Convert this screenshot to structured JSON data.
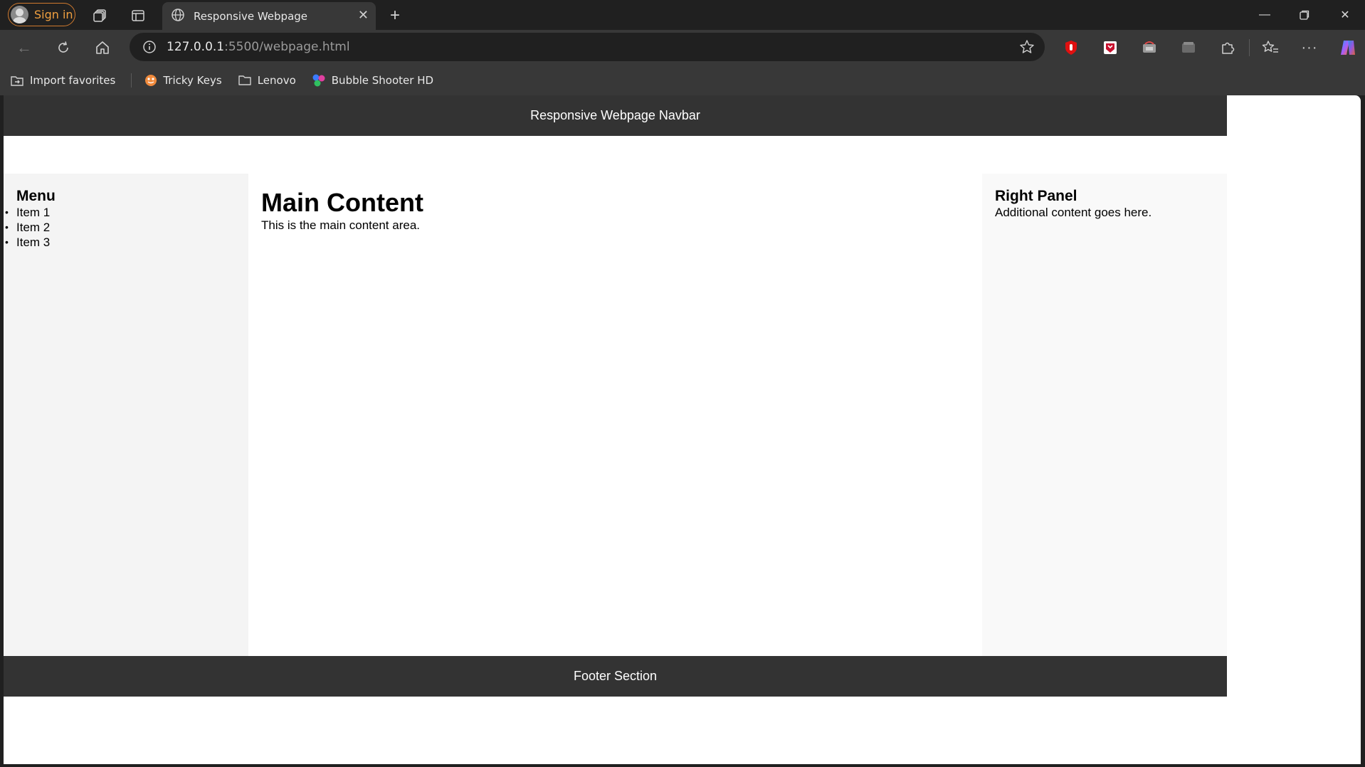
{
  "browser": {
    "signin_label": "Sign in",
    "tab_title": "Responsive Webpage",
    "url_host": "127.0.0.1",
    "url_path": ":5500/webpage.html",
    "bookmarks": [
      {
        "label": "Import favorites",
        "icon": "import-icon"
      },
      {
        "label": "Tricky Keys",
        "icon": "game-icon"
      },
      {
        "label": "Lenovo",
        "icon": "folder-icon"
      },
      {
        "label": "Bubble Shooter HD",
        "icon": "bubble-icon"
      }
    ],
    "accent_color": "#d07a2e"
  },
  "page": {
    "navbar_title": "Responsive Webpage Navbar",
    "menu": {
      "heading": "Menu",
      "items": [
        "Item 1",
        "Item 2",
        "Item 3"
      ]
    },
    "main": {
      "heading": "Main Content",
      "text": "This is the main content area."
    },
    "right_panel": {
      "heading": "Right Panel",
      "text": "Additional content goes here."
    },
    "footer_text": "Footer Section"
  }
}
